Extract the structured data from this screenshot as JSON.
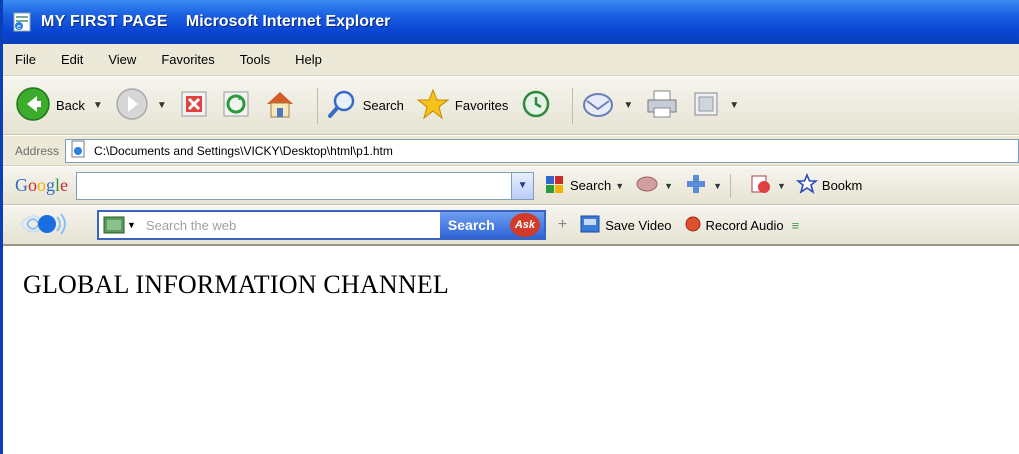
{
  "window": {
    "title": "MY FIRST PAGE",
    "app_name": "Microsoft Internet Explorer"
  },
  "menu": {
    "items": [
      "File",
      "Edit",
      "View",
      "Favorites",
      "Tools",
      "Help"
    ]
  },
  "toolbar": {
    "back_label": "Back",
    "search_label": "Search",
    "favorites_label": "Favorites"
  },
  "address": {
    "label": "Address",
    "value": "C:\\Documents and Settings\\VICKY\\Desktop\\html\\p1.htm"
  },
  "google": {
    "logo": "Google",
    "search_value": "",
    "search_label": "Search",
    "bookmarks_label": "Bookm"
  },
  "ask": {
    "placeholder": "Search the web",
    "search_button_label": "Search",
    "badge": "Ask",
    "save_video_label": "Save Video",
    "record_audio_label": "Record Audio"
  },
  "page": {
    "heading": "GLOBAL INFORMATION CHANNEL"
  },
  "colors": {
    "titlebar": "#0a46d4",
    "chrome": "#ece9d8",
    "accent": "#2f63d4"
  },
  "icons": [
    "ie-page-icon",
    "back-icon",
    "forward-icon",
    "stop-icon",
    "refresh-icon",
    "home-icon",
    "search-icon",
    "favorites-star-icon",
    "history-icon",
    "mail-icon",
    "print-icon",
    "edit-icon",
    "address-page-icon",
    "dropdown-icon",
    "ask-logo-icon",
    "save-video-icon",
    "record-audio-icon"
  ]
}
